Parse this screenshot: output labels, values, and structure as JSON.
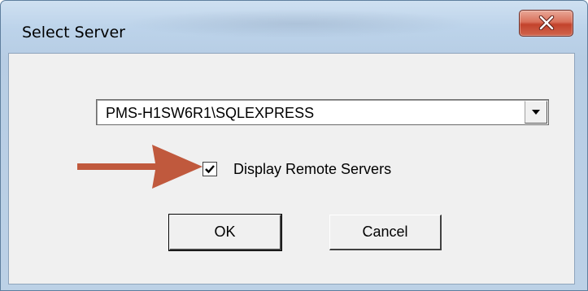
{
  "window": {
    "title": "Select Server"
  },
  "server_select": {
    "selected_value": "PMS-H1SW6R1\\SQLEXPRESS"
  },
  "remote_servers": {
    "label": "Display Remote Servers",
    "checked": true
  },
  "buttons": {
    "ok_label": "OK",
    "cancel_label": "Cancel"
  },
  "icons": {
    "close": "close-icon",
    "dropdown": "chevron-down-icon",
    "check": "checkmark-icon",
    "annotation": "arrow-right-icon"
  },
  "colors": {
    "annotation_arrow": "#c0593d",
    "close_button": "#c9503a"
  }
}
